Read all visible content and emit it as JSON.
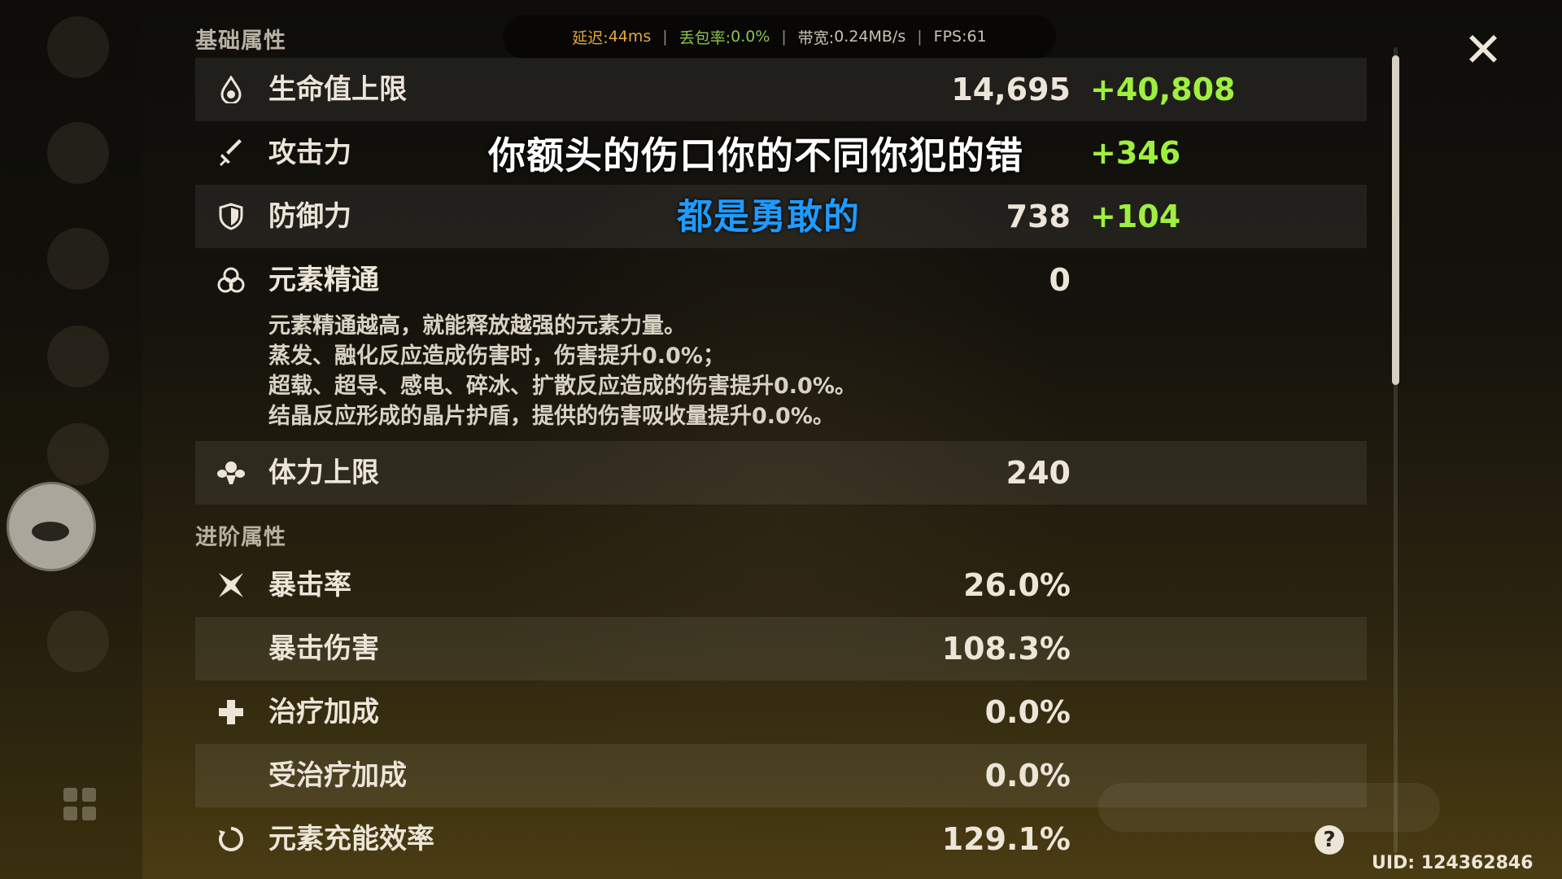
{
  "net_status": {
    "latency_label": "延迟:",
    "latency_value": "44ms",
    "loss_label": "丢包率:",
    "loss_value": "0.0%",
    "bandwidth_label": "带宽:",
    "bandwidth_value": "0.24MB/s",
    "fps_label": "FPS:",
    "fps_value": "61",
    "separator": "|"
  },
  "sections": {
    "base_title": "基础属性",
    "advanced_title": "进阶属性"
  },
  "base_stats": [
    {
      "label": "生命值上限",
      "base": "14,695",
      "bonus": "+40,808",
      "icon": "hp-drop-icon"
    },
    {
      "label": "攻击力",
      "base": "",
      "bonus": "+346",
      "icon": "sword-icon"
    },
    {
      "label": "防御力",
      "base": "738",
      "bonus": "+104",
      "icon": "shield-icon"
    },
    {
      "label": "元素精通",
      "base": "0",
      "bonus": "",
      "icon": "elemental-mastery-icon"
    },
    {
      "label": "体力上限",
      "base": "240",
      "bonus": "",
      "icon": "stamina-icon"
    }
  ],
  "mastery_description": [
    "元素精通越高，就能释放越强的元素力量。",
    "蒸发、融化反应造成伤害时，伤害提升0.0%；",
    "超载、超导、感电、碎冰、扩散反应造成的伤害提升0.0%。",
    "结晶反应形成的晶片护盾，提供的伤害吸收量提升0.0%。"
  ],
  "advanced_stats": [
    {
      "label": "暴击率",
      "value": "26.0%",
      "icon": "crit-rate-icon"
    },
    {
      "label": "暴击伤害",
      "value": "108.3%",
      "icon": ""
    },
    {
      "label": "治疗加成",
      "value": "0.0%",
      "icon": "healing-cross-icon"
    },
    {
      "label": "受治疗加成",
      "value": "0.0%",
      "icon": ""
    },
    {
      "label": "元素充能效率",
      "value": "129.1%",
      "icon": "energy-recharge-icon"
    }
  ],
  "subtitles": {
    "line1": "你额头的伤口你的不同你犯的错",
    "line2": "都是勇敢的"
  },
  "uid": "UID: 124362846",
  "help_glyph": "?",
  "close_glyph": "✕",
  "colors": {
    "bonus_green": "#9ff03e",
    "latency_orange": "#e2a93a",
    "loss_green": "#8bc34a",
    "subtitle_blue": "#1e9bff"
  }
}
